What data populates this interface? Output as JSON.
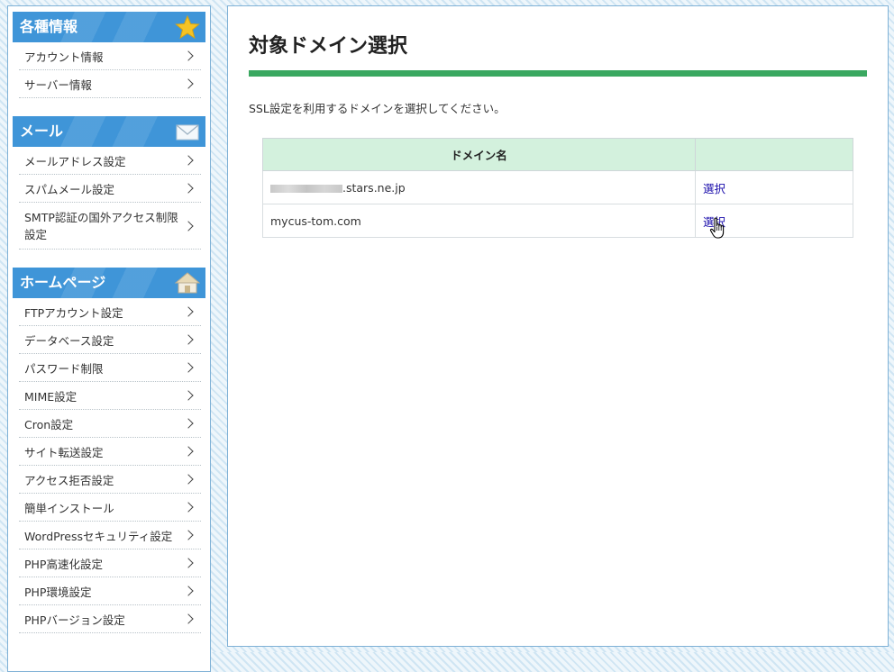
{
  "sidebar": {
    "sections": [
      {
        "title": "各種情報",
        "icon": "star-icon",
        "items": [
          "アカウント情報",
          "サーバー情報"
        ]
      },
      {
        "title": "メール",
        "icon": "envelope-icon",
        "items": [
          "メールアドレス設定",
          "スパムメール設定",
          "SMTP認証の国外アクセス制限設定"
        ]
      },
      {
        "title": "ホームページ",
        "icon": "house-icon",
        "items": [
          "FTPアカウント設定",
          "データベース設定",
          "パスワード制限",
          "MIME設定",
          "Cron設定",
          "サイト転送設定",
          "アクセス拒否設定",
          "簡単インストール",
          "WordPressセキュリティ設定",
          "PHP高速化設定",
          "PHP環境設定",
          "PHPバージョン設定"
        ]
      }
    ]
  },
  "main": {
    "title": "対象ドメイン選択",
    "description": "SSL設定を利用するドメインを選択してください。",
    "table": {
      "headers": [
        "ドメイン名",
        ""
      ],
      "rows": [
        {
          "domain": ".stars.ne.jp",
          "domain_redacted": true,
          "action": "選択"
        },
        {
          "domain": "mycus-tom.com",
          "action": "選択"
        }
      ]
    }
  },
  "colors": {
    "accent_blue": "#3f95d8",
    "accent_green": "#3aa860",
    "table_header": "#d3f1dd",
    "link": "#1a0dab"
  }
}
